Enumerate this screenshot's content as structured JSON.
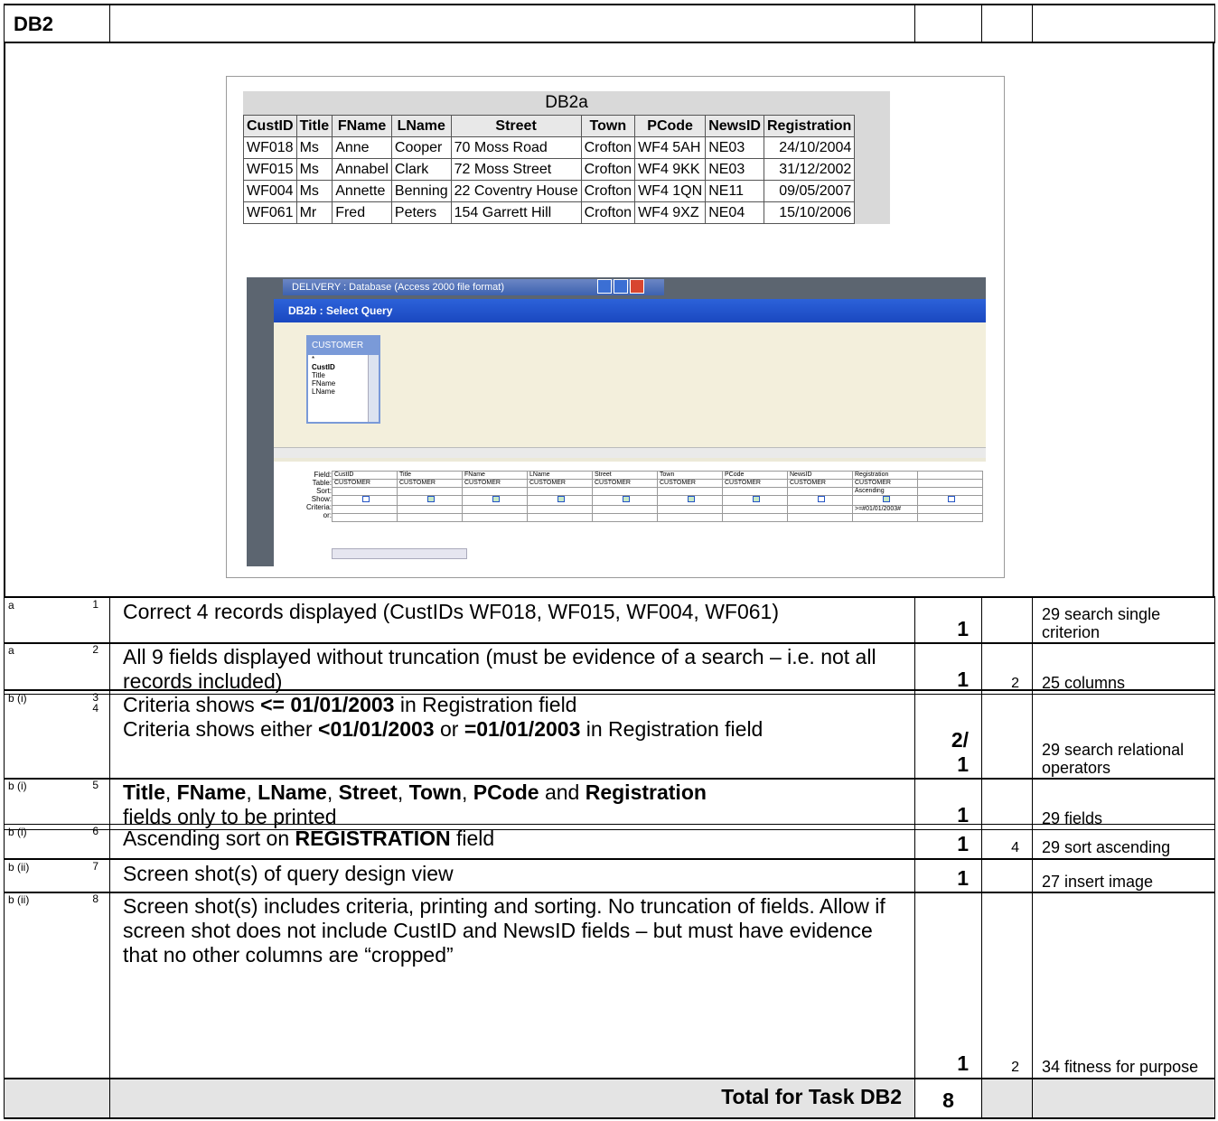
{
  "task": {
    "id": "DB2"
  },
  "report": {
    "title": "DB2a",
    "headers": [
      "CustID",
      "Title",
      "FName",
      "LName",
      "Street",
      "Town",
      "PCode",
      "NewsID",
      "Registration"
    ],
    "rows": [
      [
        "WF018",
        "Ms",
        "Anne",
        "Cooper",
        "70 Moss Road",
        "Crofton",
        "WF4 5AH",
        "NE03",
        "24/10/2004"
      ],
      [
        "WF015",
        "Ms",
        "Annabel",
        "Clark",
        "72 Moss Street",
        "Crofton",
        "WF4 9KK",
        "NE03",
        "31/12/2002"
      ],
      [
        "WF004",
        "Ms",
        "Annette",
        "Benning",
        "22 Coventry House",
        "Crofton",
        "WF4 1QN",
        "NE11",
        "09/05/2007"
      ],
      [
        "WF061",
        "Mr",
        "Fred",
        "Peters",
        "154 Garrett Hill",
        "Crofton",
        "WF4 9XZ",
        "NE04",
        "15/10/2006"
      ]
    ]
  },
  "access": {
    "db_title": "DELIVERY : Database (Access 2000 file format)",
    "query_title": "DB2b : Select Query",
    "table_name": "CUSTOMER",
    "table_fields": [
      "*",
      "CustID",
      "Title",
      "FName",
      "LName"
    ],
    "row_labels": [
      "Field:",
      "Table:",
      "Sort:",
      "Show:",
      "Criteria:",
      "or:"
    ],
    "grid_fields": [
      "CustID",
      "Title",
      "FName",
      "LName",
      "Street",
      "Town",
      "PCode",
      "NewsID",
      "Registration"
    ],
    "grid_table": "CUSTOMER",
    "sort_value": "Ascending",
    "criteria_value": ">=#01/01/2003#",
    "show": [
      false,
      true,
      true,
      true,
      true,
      true,
      true,
      false,
      true
    ]
  },
  "criteria_rows": [
    {
      "q": "a",
      "m": "1",
      "lines": [
        {
          "t": "Correct 4 records displayed (CustIDs WF018, WF015, WF004, WF061)"
        }
      ],
      "mark": "1",
      "check": "",
      "skill": "29 search single criterion"
    },
    {
      "q": "a",
      "m": "2",
      "lines": [
        {
          "t": "All 9 fields displayed without truncation (must be evidence of a search – i.e. not all records included)"
        }
      ],
      "mark": "1",
      "check": "2",
      "skill": "25 columns"
    },
    {
      "q": "b (i)",
      "m": "3\n4",
      "mark": "2/\n1",
      "check": "",
      "skill": "29 search relational operators"
    },
    {
      "q": "b (i)",
      "m": "5",
      "mark": "1",
      "check": "",
      "skill": "29 fields"
    },
    {
      "q": "b (i)",
      "m": "6",
      "mark": "1",
      "check": "4",
      "skill": "29 sort ascending"
    },
    {
      "q": "b (ii)",
      "m": "7",
      "lines": [
        {
          "t": "Screen shot(s) of query design view"
        }
      ],
      "mark": "1",
      "check": "",
      "skill": "27 insert image"
    },
    {
      "q": "b (ii)",
      "m": "8",
      "lines": [
        {
          "t": "Screen shot(s) includes criteria, printing and sorting. No truncation of fields. Allow if screen shot does not include CustID and NewsID fields – but must have evidence that no other columns are “cropped”"
        }
      ],
      "mark": "1",
      "check": "2",
      "skill": "34 fitness for purpose"
    }
  ],
  "rich": {
    "r3_a": "Criteria shows ",
    "r3_b": "<= 01/01/2003",
    "r3_c": " in Registration field",
    "r3_d": "Criteria shows either ",
    "r3_e": "<01/01/2003",
    "r3_f": " or ",
    "r3_g": "=01/01/2003",
    "r3_h": " in Registration field",
    "r5_fields": [
      "Title",
      "FName",
      "LName",
      "Street",
      "Town",
      "PCode"
    ],
    "r5_and": " and ",
    "r5_last": "Registration",
    "r5_tail": "fields only to be printed",
    "r6_a": "Ascending sort on ",
    "r6_b": "REGISTRATION",
    "r6_c": " field"
  },
  "total": {
    "label": "Total for Task DB2",
    "value": "8"
  }
}
